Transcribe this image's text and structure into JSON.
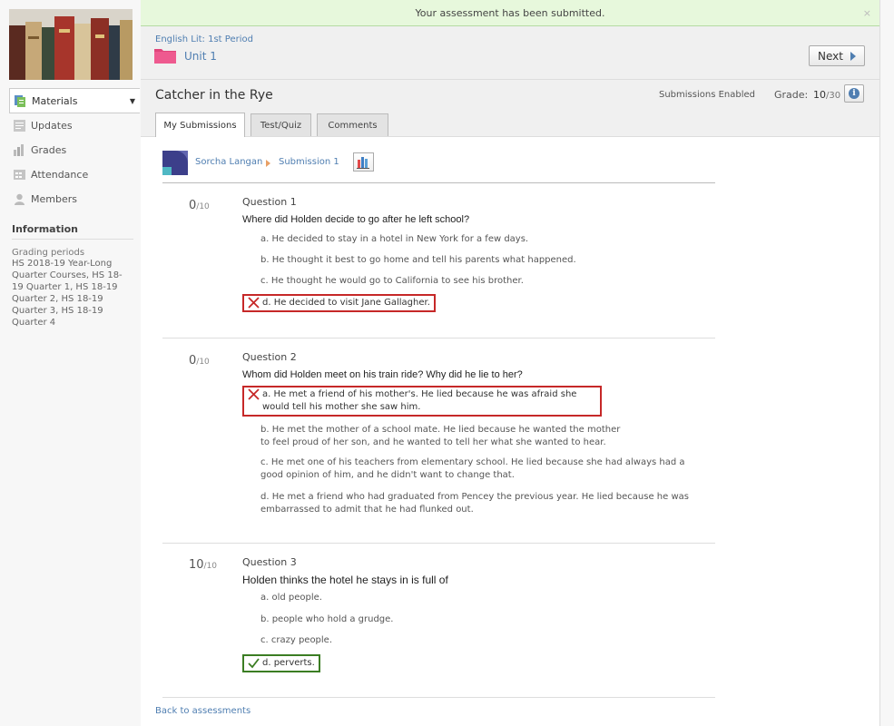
{
  "banner": {
    "message": "Your assessment has been submitted.",
    "close": "×"
  },
  "sidebar": {
    "items": [
      {
        "label": "Materials",
        "icon": "materials-icon",
        "active": true
      },
      {
        "label": "Updates",
        "icon": "updates-icon"
      },
      {
        "label": "Grades",
        "icon": "grades-icon"
      },
      {
        "label": "Attendance",
        "icon": "attendance-icon"
      },
      {
        "label": "Members",
        "icon": "members-icon"
      }
    ],
    "info_title": "Information",
    "grading_periods_label": "Grading periods",
    "grading_periods": "HS 2018-19 Year-Long Quarter Courses, HS 18-19 Quarter 1, HS 18-19 Quarter 2, HS 18-19 Quarter 3, HS 18-19 Quarter 4"
  },
  "header": {
    "breadcrumb": "English Lit: 1st Period",
    "unit": "Unit 1",
    "next_label": "Next",
    "title": "Catcher in the Rye",
    "submissions": "Submissions Enabled",
    "grade_label": "Grade:",
    "grade_score": "10",
    "grade_total": "/30"
  },
  "tabs": [
    "My Submissions",
    "Test/Quiz",
    "Comments"
  ],
  "student": {
    "name": "Sorcha Langan",
    "submission": "Submission 1"
  },
  "questions": [
    {
      "score": "0",
      "out_of": "/10",
      "title": "Question 1",
      "text": "Where did Holden decide to go after he left school?",
      "answers": [
        "a. He decided to stay in a hotel in New York for a few days.",
        "b. He thought it best to go home and tell his parents what happened.",
        "c. He thought he would go to California to see his brother.",
        "d. He decided to visit Jane Gallagher."
      ]
    },
    {
      "score": "0",
      "out_of": "/10",
      "title": "Question 2",
      "text": "Whom did Holden meet on his train ride? Why did he lie to her?",
      "answers": [
        "a. He met a friend of his mother's. He lied because he was afraid she would tell his mother she saw him.",
        "b. He met the mother of a school mate. He lied because he wanted the mother to feel proud of her son, and he wanted to tell her what she wanted to hear.",
        "c. He met one of his teachers from elementary school. He lied because she had always had a good opinion of him, and he didn't want to change that.",
        "d. He met a friend who had graduated from Pencey the previous year. He lied because he was embarrassed to admit that he had flunked out."
      ]
    },
    {
      "score": "10",
      "out_of": "/10",
      "title": "Question 3",
      "text": "Holden thinks the hotel he stays in is full of",
      "answers": [
        "a. old people.",
        "b. people who hold a grudge.",
        "c. crazy people.",
        "d. perverts."
      ]
    }
  ],
  "back_link": "Back to assessments",
  "colors": {
    "link": "#4f7eb1",
    "wrong": "#c62828",
    "correct": "#3b7d23",
    "banner": "#e7f8dc"
  }
}
